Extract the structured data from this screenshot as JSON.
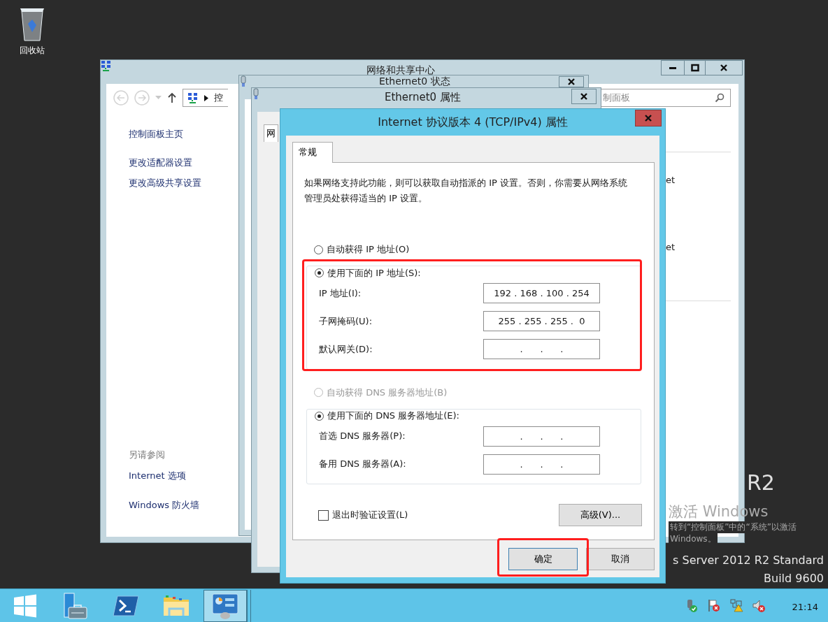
{
  "desktop": {
    "icons": [
      {
        "label": "回收站"
      }
    ],
    "branding": [
      {
        "kind": "logo",
        "text": "R2"
      },
      {
        "kind": "edition",
        "text": "s Server 2012 R2 Standard"
      },
      {
        "kind": "build",
        "text": "Build 9600"
      }
    ],
    "activation_notice": {
      "title": "激活 Windows",
      "lines": [
        "转到“控制面板”中的“系统”以激活",
        "Windows。"
      ]
    }
  },
  "network_center": {
    "title": "网络和共享中心",
    "address": {
      "segments": [
        "控"
      ]
    },
    "search": {
      "placeholder": "制面板"
    },
    "sidebar": {
      "items": [
        {
          "label": "控制面板主页"
        },
        {
          "label": "更改适配器设置"
        },
        {
          "label": "更改高级共享设置"
        }
      ]
    },
    "see_also": {
      "heading": "另请参阅",
      "links": [
        "Internet 选项",
        "Windows 防火墙"
      ]
    },
    "content_fragments": [
      "et",
      "et"
    ]
  },
  "ethernet_status": {
    "title": "Ethernet0 状态"
  },
  "ethernet_properties": {
    "title": "Ethernet0 属性",
    "tabs": [
      {
        "label": "网",
        "selected": true
      }
    ]
  },
  "ipv4_dialog": {
    "title": "Internet 协议版本 4 (TCP/IPv4) 属性",
    "tabs": [
      {
        "label": "常规",
        "selected": true
      }
    ],
    "description": "如果网络支持此功能，则可以获取自动指派的 IP 设置。否则，你需要从网络系统管理员处获得适当的 IP 设置。",
    "ip_mode": [
      {
        "label": "自动获得 IP 地址(O)",
        "selected": false,
        "disabled": false
      },
      {
        "label": "使用下面的 IP 地址(S):",
        "selected": true,
        "disabled": false
      }
    ],
    "ip_group": {
      "highlighted": true,
      "fields": [
        {
          "label": "IP 地址(I):",
          "value": "192 . 168 . 100 . 254"
        },
        {
          "label": "子网掩码(U):",
          "value": "255 . 255 . 255 .  0"
        },
        {
          "label": "默认网关(D):",
          "value": ".      .      ."
        }
      ]
    },
    "dns_mode": [
      {
        "label": "自动获得 DNS 服务器地址(B)",
        "selected": false,
        "disabled": true
      },
      {
        "label": "使用下面的 DNS 服务器地址(E):",
        "selected": true,
        "disabled": false
      }
    ],
    "dns_group": {
      "fields": [
        {
          "label": "首选 DNS 服务器(P):",
          "value": ".      .      ."
        },
        {
          "label": "备用 DNS 服务器(A):",
          "value": ".      .      ."
        }
      ]
    },
    "validate_checkbox": {
      "label": "退出时验证设置(L)",
      "checked": false
    },
    "advanced_button": "高级(V)...",
    "buttons": [
      {
        "label": "确定",
        "highlighted": true
      },
      {
        "label": "取消",
        "highlighted": false
      }
    ]
  },
  "taskbar": {
    "items": [
      {
        "kind": "start",
        "selected": false
      },
      {
        "kind": "server-manager",
        "selected": false
      },
      {
        "kind": "powershell",
        "selected": false
      },
      {
        "kind": "explorer",
        "selected": false
      },
      {
        "kind": "control-panel",
        "selected": true
      }
    ],
    "tray": [
      {
        "kind": "network-ok"
      },
      {
        "kind": "flag-error"
      },
      {
        "kind": "network-warning"
      },
      {
        "kind": "speaker-muted"
      }
    ],
    "clock": {
      "time": "21:14"
    }
  }
}
